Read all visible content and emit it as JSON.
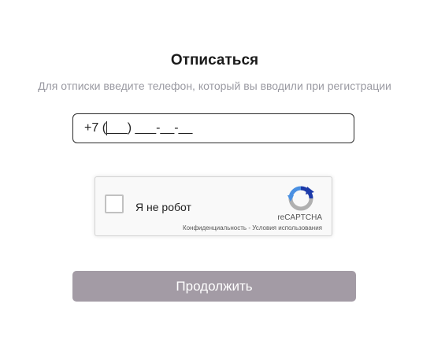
{
  "form": {
    "title": "Отписаться",
    "subtitle": "Для отписки введите телефон, который вы вводили при регистрации",
    "phone_value": "+7 (___) ___-__-__",
    "submit_label": "Продолжить"
  },
  "recaptcha": {
    "label": "Я не робот",
    "brand": "reCAPTCHA",
    "privacy_link": "Конфиденциальность",
    "separator": " - ",
    "terms_link": "Условия использования",
    "logo_icon": "recaptcha-logo-icon",
    "checked": false
  },
  "colors": {
    "button_bg": "#a39ba5",
    "subtitle_text": "#9a9aa2",
    "recaptcha_blue": "#1c3aa9",
    "recaptcha_light_blue": "#4a90e2",
    "recaptcha_grey": "#b0b0b0"
  }
}
